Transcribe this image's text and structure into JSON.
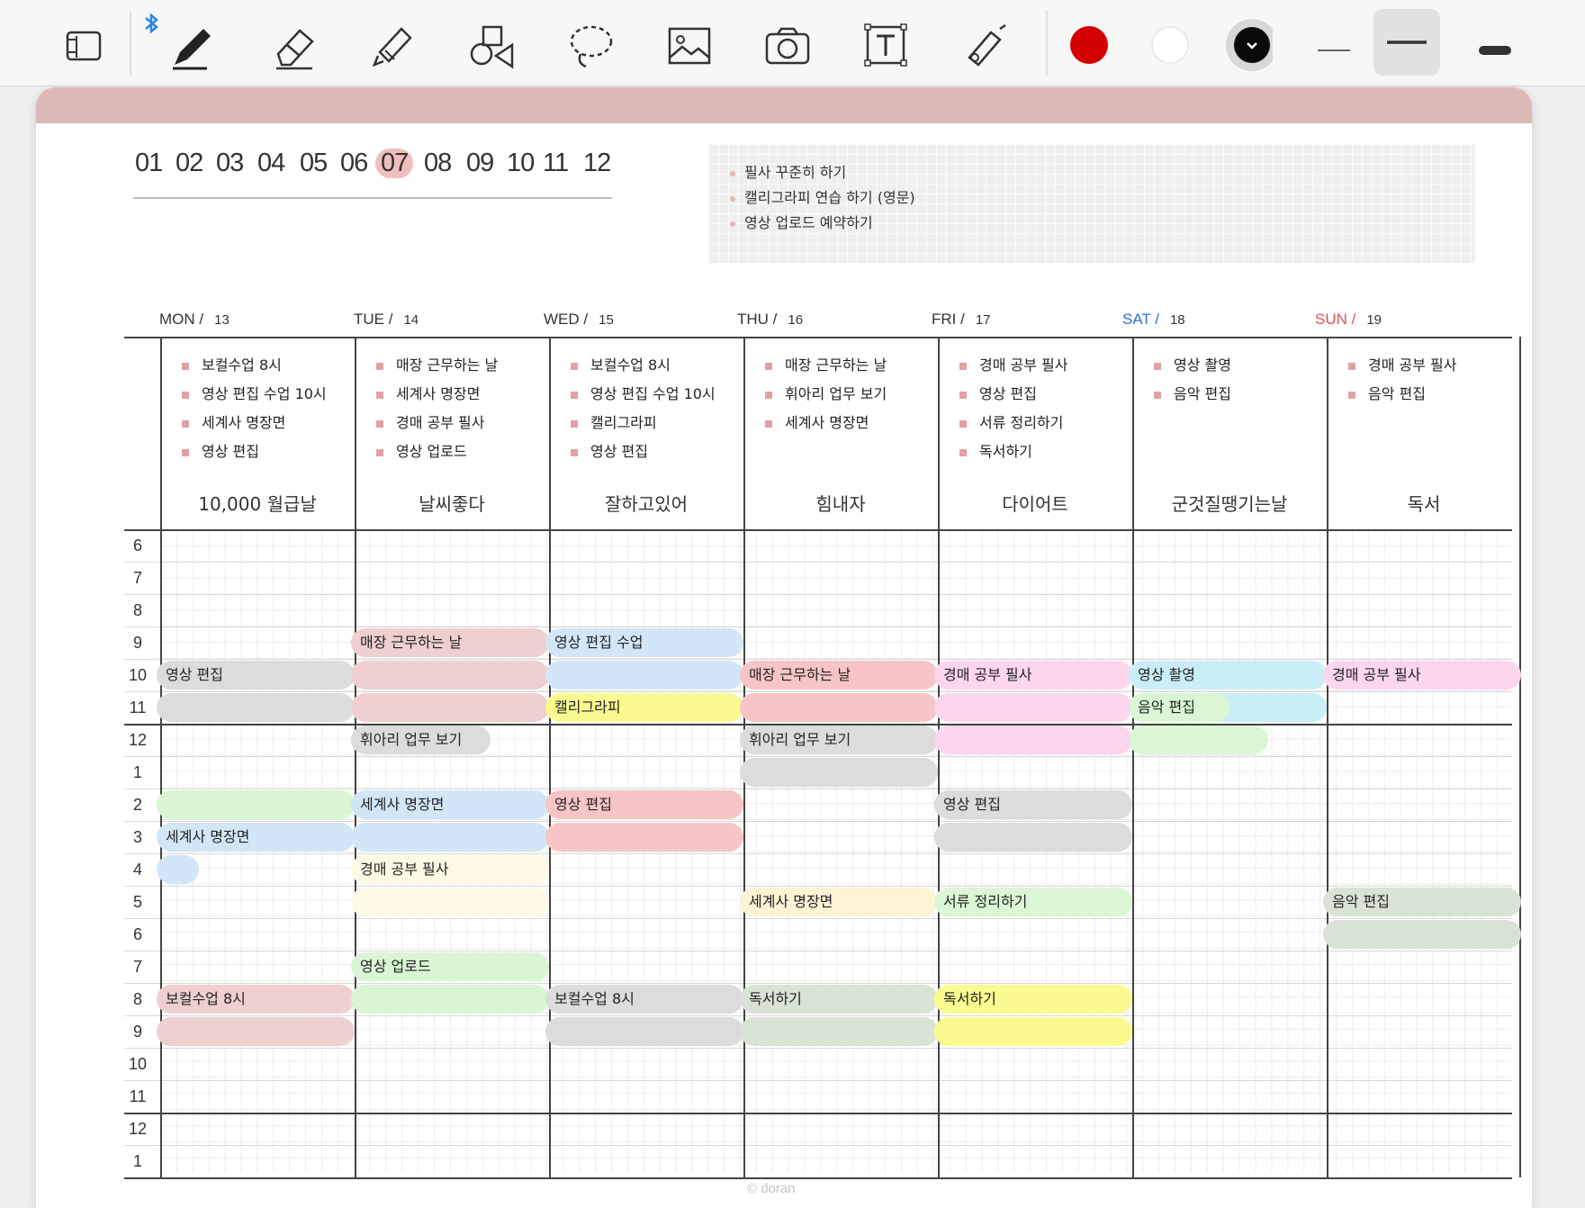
{
  "toolbar": {
    "tools": [
      {
        "name": "sidebar-toggle-icon"
      },
      {
        "name": "pen-icon",
        "selected": true
      },
      {
        "name": "eraser-icon"
      },
      {
        "name": "highlighter-icon"
      },
      {
        "name": "shapes-icon"
      },
      {
        "name": "lasso-icon"
      },
      {
        "name": "image-icon"
      },
      {
        "name": "camera-icon"
      },
      {
        "name": "text-icon"
      },
      {
        "name": "laser-pointer-icon"
      }
    ],
    "colors": [
      "#d40000",
      "#ffffff",
      "#000000"
    ],
    "bluetooth_icon": "bluetooth-icon"
  },
  "months": [
    "01",
    "02",
    "03",
    "04",
    "05",
    "06",
    "07",
    "08",
    "09",
    "10",
    "11",
    "12"
  ],
  "selected_month": "07",
  "goals": [
    "필사 꾸준히 하기",
    "캘리그라피 연습 하기 (영문)",
    "영상 업로드 예약하기"
  ],
  "days": [
    {
      "label": "MON /",
      "date": "13",
      "color": "#333333",
      "todos": [
        "보컬수업 8시",
        "영상 편집 수업 10시",
        "세계사 명장면",
        "영상 편집"
      ],
      "sticker": "10,000 월급날"
    },
    {
      "label": "TUE /",
      "date": "14",
      "color": "#333333",
      "todos": [
        "매장 근무하는 날",
        "세계사 명장면",
        "경매 공부 필사",
        "영상 업로드"
      ],
      "sticker": "날씨좋다"
    },
    {
      "label": "WED /",
      "date": "15",
      "color": "#333333",
      "todos": [
        "보컬수업 8시",
        "영상 편집 수업 10시",
        "캘리그라피",
        "영상 편집"
      ],
      "sticker": "잘하고있어"
    },
    {
      "label": "THU /",
      "date": "16",
      "color": "#333333",
      "todos": [
        "매장 근무하는 날",
        "휘아리 업무 보기",
        "세계사 명장면"
      ],
      "sticker": "힘내자"
    },
    {
      "label": "FRI /",
      "date": "17",
      "color": "#333333",
      "todos": [
        "경매 공부 필사",
        "영상 편집",
        "서류 정리하기",
        "독서하기"
      ],
      "sticker": "다이어트"
    },
    {
      "label": "SAT /",
      "date": "18",
      "color": "#2d6fd6",
      "todos": [
        "영상 촬영",
        "음악 편집"
      ],
      "sticker": "군것질땡기는날"
    },
    {
      "label": "SUN /",
      "date": "19",
      "color": "#e05050",
      "todos": [
        "경매 공부 필사",
        "음악 편집"
      ],
      "sticker": "독서"
    }
  ],
  "hours": [
    "6",
    "7",
    "8",
    "9",
    "10",
    "11",
    "12",
    "1",
    "2",
    "3",
    "4",
    "5",
    "6",
    "7",
    "8",
    "9",
    "10",
    "11",
    "12",
    "1"
  ],
  "blocks": [
    {
      "text": "영상 편집",
      "day": 0,
      "start": 4.0,
      "rows": 2,
      "width": 1,
      "color": "#dcdcdc"
    },
    {
      "text": "",
      "day": 0,
      "start": 8.0,
      "rows": 1,
      "width": 1,
      "color": "#d9f5d3"
    },
    {
      "text": "세계사 명장면",
      "day": 0,
      "start": 9.0,
      "rows": 1,
      "width": 1,
      "color": "#d3e6f8"
    },
    {
      "text": "",
      "day": 0,
      "start": 10.0,
      "rows": 1,
      "width": 0.2,
      "color": "#d3e6f8"
    },
    {
      "text": "보컬수업 8시",
      "day": 0,
      "start": 14.0,
      "rows": 2,
      "width": 1,
      "color": "#efcfcf"
    },
    {
      "text": "매장 근무하는 날",
      "day": 1,
      "start": 3.0,
      "rows": 3,
      "width": 1,
      "color": "#efcfcf"
    },
    {
      "text": "휘아리 업무 보기",
      "day": 1,
      "start": 6.0,
      "rows": 1,
      "width": 0.7,
      "color": "#dcdcdc"
    },
    {
      "text": "세계사 명장면",
      "day": 1,
      "start": 8.0,
      "rows": 2,
      "width": 1,
      "color": "#d3e6f8"
    },
    {
      "text": "경매 공부 필사",
      "day": 1,
      "start": 10.0,
      "rows": 2,
      "width": 1,
      "color": "#fdf9e5"
    },
    {
      "text": "영상 업로드",
      "day": 1,
      "start": 13.0,
      "rows": 2,
      "width": 1,
      "color": "#d9f5d3"
    },
    {
      "text": "영상 편집 수업",
      "day": 2,
      "start": 3.0,
      "rows": 2,
      "width": 1,
      "color": "#d3e6f8"
    },
    {
      "text": "캘리그라피",
      "day": 2,
      "start": 5.0,
      "rows": 1,
      "width": 1,
      "color": "#fafa90"
    },
    {
      "text": "영상 편집",
      "day": 2,
      "start": 8.0,
      "rows": 2,
      "width": 1,
      "color": "#f7c5c5"
    },
    {
      "text": "보컬수업 8시",
      "day": 2,
      "start": 14.0,
      "rows": 2,
      "width": 1,
      "color": "#dcdcdc"
    },
    {
      "text": "매장 근무하는 날",
      "day": 3,
      "start": 4.0,
      "rows": 2,
      "width": 1,
      "color": "#f7c5c5"
    },
    {
      "text": "휘아리 업무 보기",
      "day": 3,
      "start": 6.0,
      "rows": 2,
      "width": 1,
      "color": "#dcdcdc"
    },
    {
      "text": "세계사 명장면",
      "day": 3,
      "start": 11.0,
      "rows": 1,
      "width": 1,
      "color": "#fdf4d6"
    },
    {
      "text": "독서하기",
      "day": 3,
      "start": 14.0,
      "rows": 2,
      "width": 1,
      "color": "#d8e3d5"
    },
    {
      "text": "경매 공부 필사",
      "day": 4,
      "start": 4.0,
      "rows": 3,
      "width": 1,
      "color": "#fcd5ef"
    },
    {
      "text": "영상 편집",
      "day": 4,
      "start": 8.0,
      "rows": 2,
      "width": 1,
      "color": "#dcdcdc"
    },
    {
      "text": "서류 정리하기",
      "day": 4,
      "start": 11.0,
      "rows": 1,
      "width": 1,
      "color": "#daf6d5"
    },
    {
      "text": "독서하기",
      "day": 4,
      "start": 14.0,
      "rows": 2,
      "width": 1,
      "color": "#fafa90"
    },
    {
      "text": "영상 촬영",
      "day": 5,
      "start": 4.0,
      "rows": 2,
      "width": 1,
      "color": "#caeef8"
    },
    {
      "text": "음악 편집",
      "day": 5,
      "start": 5.0,
      "rows": 1,
      "width": 0.5,
      "color": "#daf6d5"
    },
    {
      "text": "",
      "day": 5,
      "start": 6.0,
      "rows": 1,
      "width": 0.7,
      "color": "#daf6d5"
    },
    {
      "text": "경매 공부 필사",
      "day": 6,
      "start": 4.0,
      "rows": 1,
      "width": 1,
      "color": "#fcd5ef"
    },
    {
      "text": "음악 편집",
      "day": 6,
      "start": 11.0,
      "rows": 2,
      "width": 1,
      "color": "#d8e3d5"
    }
  ],
  "copyright": "© doran"
}
